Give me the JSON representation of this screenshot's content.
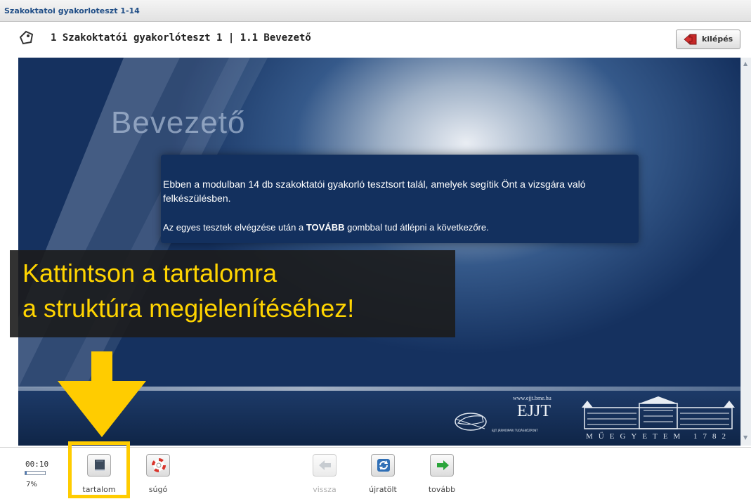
{
  "window": {
    "title": "Szakoktatoi gyakorloteszt 1-14"
  },
  "header": {
    "lesson_title": "1 Szakoktatói gyakorlóteszt 1 | 1.1 Bevezető",
    "exit_label": "kilépés"
  },
  "slide": {
    "heading": "Bevezető",
    "paragraph1": "Ebben a modulban 14 db szakoktatói gyakorló tesztsort talál, amelyek segítik Önt a vizsgára való felkészülésben.",
    "paragraph2_prefix": "Az egyes tesztek elvégzése után a",
    "paragraph2_bold": "TOVÁBB",
    "paragraph2_suffix": "gombbal tud átlépni a következőre.",
    "ejjt_url": "www.ejjt.bme.hu",
    "ejjt_logo": "EJJT",
    "ejjt_sub": "EJJT JÁRMŰIPARI TUDÁSKÖZPONT",
    "university_text": "MŰEGYETEM 1782"
  },
  "tooltip": {
    "line1": "Kattintson a tartalomra",
    "line2": "a struktúra megjelenítéséhez!"
  },
  "player": {
    "time": "00:10",
    "progress_percent": 7,
    "progress_label": "7%",
    "buttons": {
      "contents": {
        "label": "tartalom",
        "icon": "book-icon"
      },
      "help": {
        "label": "súgó",
        "icon": "lifebuoy-icon"
      },
      "back": {
        "label": "vissza",
        "icon": "arrow-left-icon"
      },
      "reload": {
        "label": "újratölt",
        "icon": "refresh-icon"
      },
      "next": {
        "label": "tovább",
        "icon": "arrow-right-icon"
      }
    }
  },
  "colors": {
    "highlight": "#ffcc00",
    "tooltip_text": "#ffd400",
    "slide_bg": "#15315f",
    "title_text": "#1f4d86",
    "next_green": "#2aa53a"
  }
}
